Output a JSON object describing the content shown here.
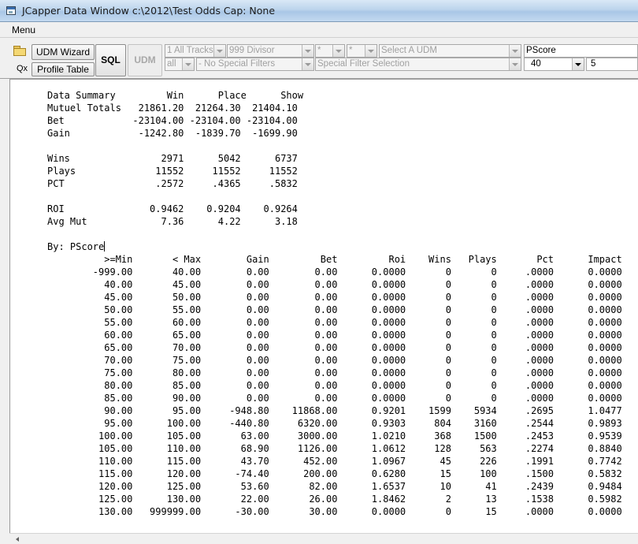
{
  "window": {
    "title": "JCapper Data Window c:\\2012\\Test Odds Cap: None"
  },
  "menu": {
    "label": "Menu"
  },
  "toolbar": {
    "udm_wizard": "UDM Wizard",
    "profile_table": "Profile Table",
    "sql": "SQL",
    "udm": "UDM",
    "qx": "Qx",
    "dropdowns": {
      "tracks": "1 All Tracks",
      "divisor": "999 Divisor",
      "star1": "*",
      "star2": "*",
      "udm_select": "Select A UDM",
      "factor": "PScore",
      "all": "all",
      "special_filters": "- No Special Filters",
      "special_filter_selection": "Special Filter Selection",
      "rows": "40",
      "step": "5"
    }
  },
  "report": {
    "summary_lines": [
      "Data Summary         Win      Place      Show",
      "Mutuel Totals   21861.20  21264.30  21404.10",
      "Bet            -23104.00 -23104.00 -23104.00",
      "Gain            -1242.80  -1839.70  -1699.90",
      "",
      "Wins                2971      5042      6737",
      "Plays              11552     11552     11552",
      "PCT                .2572     .4365     .5832",
      "",
      "ROI               0.9462    0.9204    0.9264",
      "Avg Mut             7.36      4.22      3.18",
      ""
    ],
    "by_label": "By: PScore",
    "table_header": "          >=Min       < Max        Gain         Bet         Roi    Wins   Plays       Pct      Impact",
    "table_rows": [
      "        -999.00       40.00        0.00        0.00      0.0000       0       0     .0000      0.0000",
      "          40.00       45.00        0.00        0.00      0.0000       0       0     .0000      0.0000",
      "          45.00       50.00        0.00        0.00      0.0000       0       0     .0000      0.0000",
      "          50.00       55.00        0.00        0.00      0.0000       0       0     .0000      0.0000",
      "          55.00       60.00        0.00        0.00      0.0000       0       0     .0000      0.0000",
      "          60.00       65.00        0.00        0.00      0.0000       0       0     .0000      0.0000",
      "          65.00       70.00        0.00        0.00      0.0000       0       0     .0000      0.0000",
      "          70.00       75.00        0.00        0.00      0.0000       0       0     .0000      0.0000",
      "          75.00       80.00        0.00        0.00      0.0000       0       0     .0000      0.0000",
      "          80.00       85.00        0.00        0.00      0.0000       0       0     .0000      0.0000",
      "          85.00       90.00        0.00        0.00      0.0000       0       0     .0000      0.0000",
      "          90.00       95.00     -948.80    11868.00      0.9201    1599    5934     .2695      1.0477",
      "          95.00      100.00     -440.80     6320.00      0.9303     804    3160     .2544      0.9893",
      "         100.00      105.00       63.00     3000.00      1.0210     368    1500     .2453      0.9539",
      "         105.00      110.00       68.90     1126.00      1.0612     128     563     .2274      0.8840",
      "         110.00      115.00       43.70      452.00      1.0967      45     226     .1991      0.7742",
      "         115.00      120.00      -74.40      200.00      0.6280      15     100     .1500      0.5832",
      "         120.00      125.00       53.60       82.00      1.6537      10      41     .2439      0.9484",
      "         125.00      130.00       22.00       26.00      1.8462       2      13     .1538      0.5982",
      "         130.00   999999.00      -30.00       30.00      0.0000       0      15     .0000      0.0000"
    ]
  }
}
